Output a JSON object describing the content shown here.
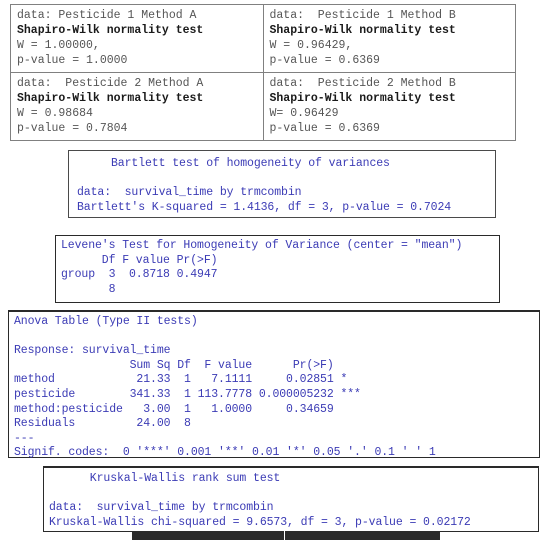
{
  "shapiro_table": {
    "name": "shapiro-wilk-normality-results",
    "rows": [
      {
        "cells": [
          {
            "data_label": "data: Pesticide 1 Method A",
            "test_title": "Shapiro-Wilk normality test",
            "statistic": "W = 1.00000,",
            "pvalue": "p-value = 1.0000"
          },
          {
            "data_label": "data:  Pesticide 1 Method B",
            "test_title": "Shapiro-Wilk normality test",
            "statistic": "W = 0.96429,",
            "pvalue": "p-value = 0.6369"
          }
        ]
      },
      {
        "cells": [
          {
            "data_label": "data:  Pesticide 2 Method A",
            "test_title": "Shapiro-Wilk normality test",
            "statistic": "W = 0.98684",
            "pvalue": "p-value = 0.7804"
          },
          {
            "data_label": "data:  Pesticide 2 Method B",
            "test_title": "Shapiro-Wilk normality test",
            "statistic": "W= 0.96429",
            "pvalue": "p-value = 0.6369"
          }
        ]
      }
    ]
  },
  "bartlett": {
    "title": "     Bartlett test of homogeneity of variances",
    "blank": " ",
    "data_line": "data:  survival_time by trmcombin",
    "result_line": "Bartlett's K-squared = 1.4136, df = 3, p-value = 0.7024"
  },
  "levene": {
    "title": "Levene's Test for Homogeneity of Variance (center = \"mean\")",
    "header": "      Df F value Pr(>F)",
    "group_row": "group  3  0.8718 0.4947",
    "resid_row": "       8"
  },
  "anova": {
    "title": "Anova Table (Type II tests)",
    "blank": " ",
    "response": "Response: survival_time",
    "header": "                 Sum Sq Df  F value      Pr(>F)",
    "rows": [
      "method            21.33  1   7.1111     0.02851 *",
      "pesticide        341.33  1 113.7778 0.000005232 ***",
      "method:pesticide   3.00  1   1.0000     0.34659",
      "Residuals         24.00  8"
    ],
    "separator": "---",
    "signif": "Signif. codes:  0 '***' 0.001 '**' 0.01 '*' 0.05 '.' 0.1 ' ' 1"
  },
  "kruskal": {
    "title": "      Kruskal-Wallis rank sum test",
    "blank": " ",
    "data_line": "data:  survival_time by trmcombin",
    "result_line": "Kruskal-Wallis chi-squared = 9.6573, df = 3, p-value = 0.02172"
  },
  "colors": {
    "console_text": "#3b3bb5",
    "table_text": "#555555",
    "table_bold_text": "#1a1a1a",
    "box_border": "#2a2a2a",
    "table_border": "#808080",
    "bottom_bar": "#2b2b2b"
  }
}
